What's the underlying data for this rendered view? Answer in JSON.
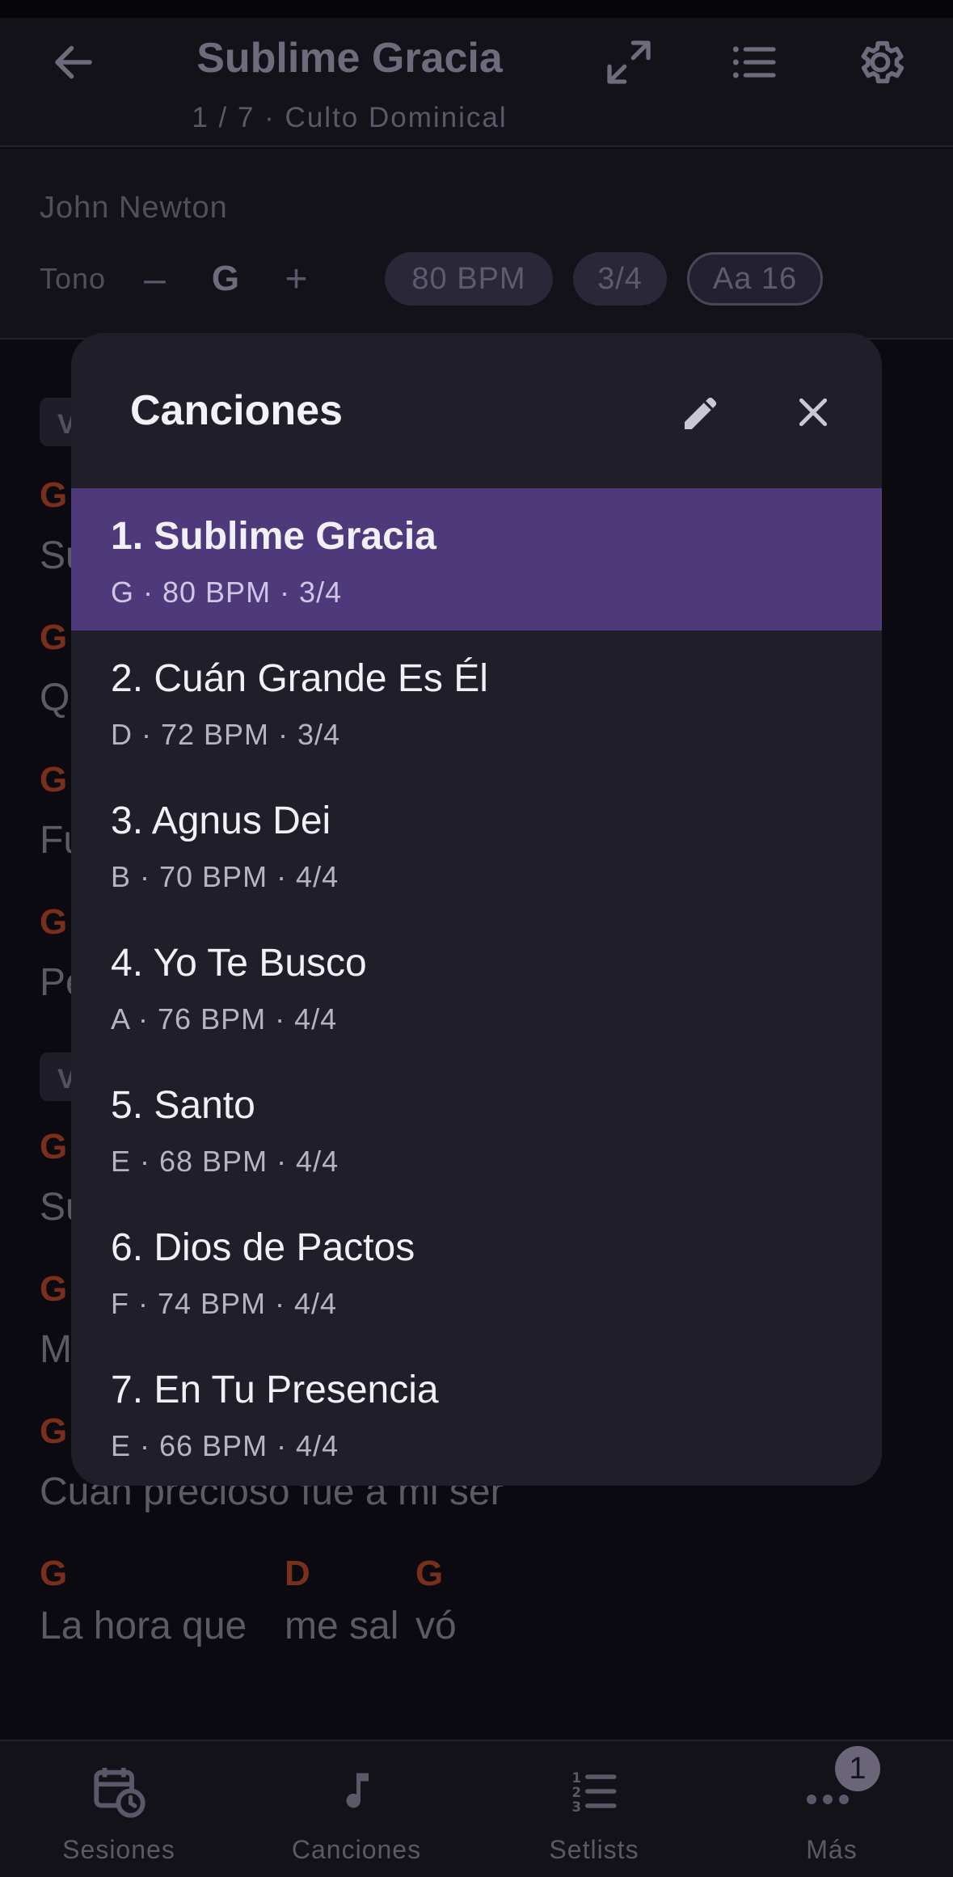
{
  "header": {
    "title": "Sublime Gracia",
    "subtitle": "1 / 7 · Culto Dominical",
    "icons": [
      "arrow-left-icon",
      "expand-icon",
      "list-icon",
      "gear-icon"
    ]
  },
  "song_info": {
    "author": "John Newton",
    "tono_label": "Tono",
    "minus": "–",
    "key": "G",
    "plus": "+",
    "bpm": "80 BPM",
    "time_signature": "3/4",
    "font_size": "Aa 16"
  },
  "song_body": {
    "sections": [
      "V",
      "V"
    ],
    "lines": [
      {
        "chord": "G",
        "lyric": "Su"
      },
      {
        "chord": "G",
        "lyric": "Q"
      },
      {
        "chord": "G",
        "lyric": "Fu"
      },
      {
        "chord": "G",
        "lyric": "Pe"
      },
      {
        "chord": "G",
        "lyric": "Su"
      },
      {
        "chord": "G",
        "lyric": "M"
      },
      {
        "chord": "G",
        "lyric": "Cuán precioso fue a mi ser"
      }
    ],
    "last_line": {
      "chords": [
        "G",
        "D",
        "G"
      ],
      "lyrics": [
        "La hora que",
        "me sal",
        "vó"
      ]
    }
  },
  "modal": {
    "title": "Canciones",
    "icons": [
      "pencil-icon",
      "close-icon"
    ],
    "songs": [
      {
        "name": "1. Sublime Gracia",
        "meta": "G · 80 BPM · 3/4",
        "active": true
      },
      {
        "name": "2. Cuán Grande Es Él",
        "meta": "D · 72 BPM · 3/4",
        "active": false
      },
      {
        "name": "3. Agnus Dei",
        "meta": "B · 70 BPM · 4/4",
        "active": false
      },
      {
        "name": "4. Yo Te Busco",
        "meta": "A · 76 BPM · 4/4",
        "active": false
      },
      {
        "name": "5. Santo",
        "meta": "E · 68 BPM · 4/4",
        "active": false
      },
      {
        "name": "6. Dios de Pactos",
        "meta": "F · 74 BPM · 4/4",
        "active": false
      },
      {
        "name": "7. En Tu Presencia",
        "meta": "E · 66 BPM · 4/4",
        "active": false
      }
    ]
  },
  "nav": {
    "items": [
      {
        "label": "Sesiones",
        "icon": "calendar-clock-icon"
      },
      {
        "label": "Canciones",
        "icon": "music-note-icon"
      },
      {
        "label": "Setlists",
        "icon": "numbered-list-icon"
      },
      {
        "label": "Más",
        "icon": "more-dots-icon"
      }
    ],
    "badge": "1"
  },
  "colors": {
    "accent": "#4e3a7a",
    "chord": "#7a2f1c",
    "modal_bg": "#201e29",
    "background": "#0b0a10"
  }
}
